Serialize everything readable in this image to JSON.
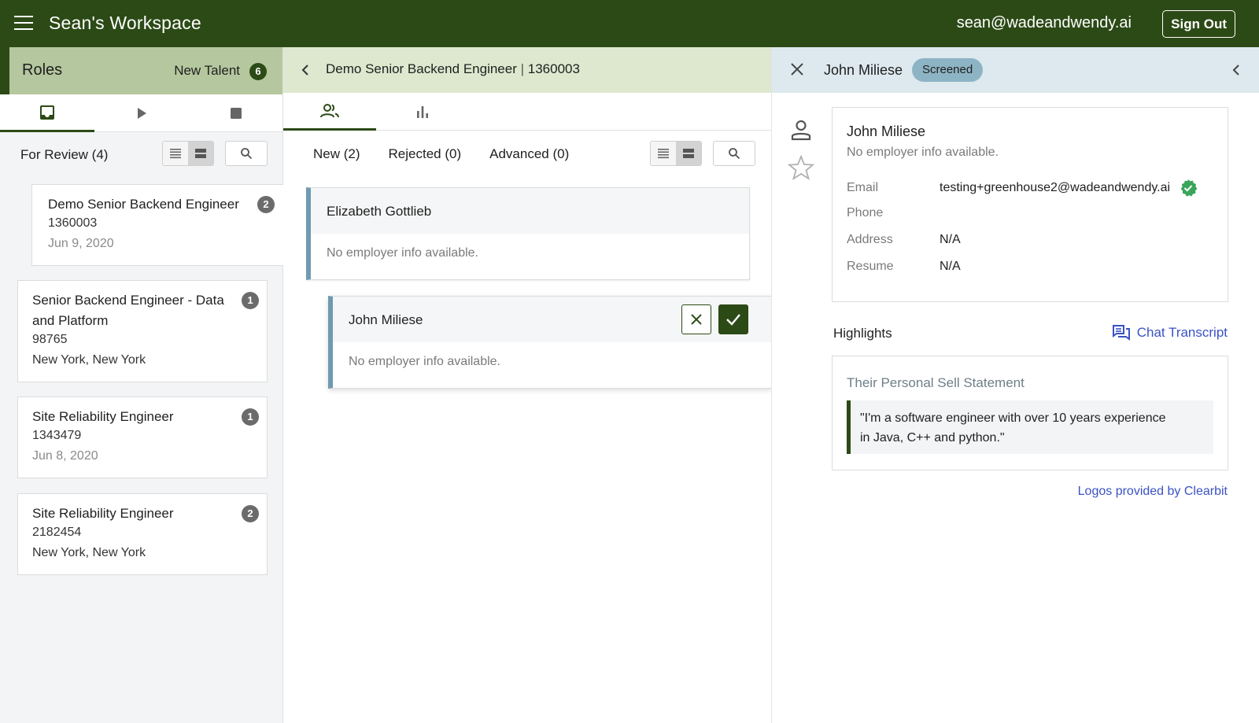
{
  "topbar": {
    "workspace_title": "Sean's Workspace",
    "user_email": "sean@wadeandwendy.ai",
    "sign_out_label": "Sign Out"
  },
  "left_panel": {
    "roles_label": "Roles",
    "new_talent_label": "New Talent",
    "new_talent_count": "6",
    "tabs": [
      {
        "name": "inbox-icon",
        "active": true
      },
      {
        "name": "play-icon",
        "active": false
      },
      {
        "name": "stop-icon",
        "active": false
      }
    ],
    "for_review_label": "For Review (4)",
    "roles": [
      {
        "title": "Demo Senior Backend Engineer",
        "id": "1360003",
        "meta": "Jun 9, 2020",
        "count": "2"
      },
      {
        "title_line1": "Senior Backend Engineer - Data",
        "title_line2": "and Platform",
        "id": "98765",
        "meta": "New York, New York",
        "count": "1"
      },
      {
        "title": "Site Reliability Engineer",
        "id": "1343479",
        "meta": "Jun 8, 2020",
        "count": "1"
      },
      {
        "title": "Site Reliability Engineer",
        "id": "2182454",
        "meta": "New York, New York",
        "count": "2"
      }
    ]
  },
  "middle_panel": {
    "role_title": "Demo Senior Backend Engineer",
    "separator": "|",
    "role_id": "1360003",
    "subtabs": [
      "New (2)",
      "Rejected (0)",
      "Advanced (0)"
    ],
    "candidates": [
      {
        "name": "Elizabeth Gottlieb",
        "employer": "No employer info available."
      },
      {
        "name": "John Miliese",
        "employer": "No employer info available."
      }
    ]
  },
  "right_panel": {
    "candidate_name": "John Miliese",
    "status": "Screened",
    "profile": {
      "name": "John Miliese",
      "employer": "No employer info available.",
      "fields": [
        {
          "key": "Email",
          "value": "testing+greenhouse2@wadeandwendy.ai"
        },
        {
          "key": "Phone",
          "value": ""
        },
        {
          "key": "Address",
          "value": "N/A"
        },
        {
          "key": "Resume",
          "value": "N/A"
        }
      ]
    },
    "highlights_label": "Highlights",
    "chat_transcript_label": "Chat Transcript",
    "highlight_title": "Their Personal Sell Statement",
    "highlight_quote_line1": "\"I'm a software engineer with over 10 years experience",
    "highlight_quote_line2": "in Java, C++ and python.\"",
    "clearbit_label": "Logos provided by Clearbit"
  },
  "colors": {
    "brand_green": "#2c4a16",
    "status_blue": "#8db4c4",
    "link_blue": "#3a52c4",
    "verified_green": "#3aa55a"
  }
}
